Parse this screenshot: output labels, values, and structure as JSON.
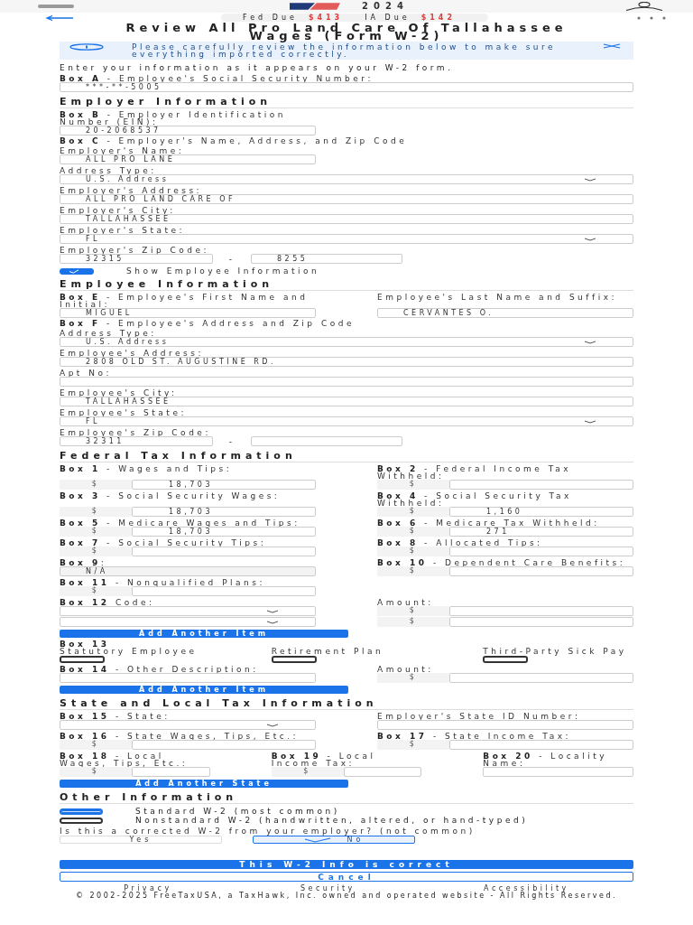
{
  "top_bar": {
    "year": "2024"
  },
  "due_bar": {
    "items": [
      {
        "label": "Fed Due",
        "amount": "$413"
      },
      {
        "label": "IA Due",
        "amount": "$142"
      }
    ]
  },
  "title": "Review All Pro Land Care Of Tallahassee Wages (Form W-2)",
  "alert": {
    "text": "Please carefully review the information below to make sure everything imported correctly."
  },
  "intro": "Enter your information as it appears on your W-2 form.",
  "blocks": [
    {
      "kind": "field",
      "label": "**Box A** - Employee's Social Security Number:",
      "inputs": [
        {
          "kind": "text",
          "value": "***-**-5005"
        }
      ]
    },
    {
      "kind": "heading",
      "text": "Employer Information"
    },
    {
      "kind": "pair",
      "cells": [
        {
          "label": "**Box B** - Employer Identification Number (EIN):",
          "inputs": [
            {
              "kind": "text",
              "value": "20-2068537"
            }
          ]
        }
      ]
    },
    {
      "kind": "note",
      "text": "**Box C** - Employer's Name, Address, and Zip Code"
    },
    {
      "kind": "pair",
      "cells": [
        {
          "label": "Employer's Name:",
          "inputs": [
            {
              "kind": "text",
              "value": "ALL PRO LANE"
            }
          ]
        }
      ]
    },
    {
      "kind": "field",
      "label": "Address Type:",
      "inputs": [
        {
          "kind": "select",
          "value": "U.S. Address"
        }
      ]
    },
    {
      "kind": "field",
      "label": "Employer's Address:",
      "inputs": [
        {
          "kind": "text",
          "value": "ALL PRO LAND CARE OF"
        }
      ]
    },
    {
      "kind": "field",
      "label": "Employer's City:",
      "inputs": [
        {
          "kind": "text",
          "value": "TALLAHASSEE"
        }
      ]
    },
    {
      "kind": "field",
      "label": "Employer's State:",
      "inputs": [
        {
          "kind": "select",
          "value": "FL"
        }
      ]
    },
    {
      "kind": "zip",
      "label": "Employer's Zip Code:",
      "joiner": "-",
      "inputs": [
        {
          "kind": "text",
          "value": "32315"
        },
        {
          "kind": "text",
          "value": "8255"
        }
      ]
    },
    {
      "kind": "checkbox",
      "label": "Show Employee Information",
      "checked": true
    },
    {
      "kind": "heading",
      "text": "Employee Information"
    },
    {
      "kind": "pair",
      "cells": [
        {
          "label": "**Box E** - Employee's First Name and Initial:",
          "inputs": [
            {
              "kind": "text",
              "value": "MIGUEL"
            }
          ]
        },
        {
          "label": "Employee's Last Name and Suffix:",
          "inputs": [
            {
              "kind": "text",
              "value": "CERVANTES O."
            }
          ]
        }
      ]
    },
    {
      "kind": "note",
      "text": "**Box F** - Employee's Address and Zip Code"
    },
    {
      "kind": "field",
      "label": "Address Type:",
      "inputs": [
        {
          "kind": "select",
          "value": "U.S. Address"
        }
      ]
    },
    {
      "kind": "field",
      "label": "Employee's Address:",
      "inputs": [
        {
          "kind": "text",
          "value": "2808 OLD ST. AUGUSTINE RD."
        }
      ]
    },
    {
      "kind": "field",
      "label": "Apt No:",
      "inputs": [
        {
          "kind": "text"
        }
      ]
    },
    {
      "kind": "field",
      "label": "Employee's City:",
      "inputs": [
        {
          "kind": "text",
          "value": "TALLAHASSEE"
        }
      ]
    },
    {
      "kind": "field",
      "label": "Employee's State:",
      "inputs": [
        {
          "kind": "select",
          "value": "FL"
        }
      ]
    },
    {
      "kind": "zip",
      "label": "Employee's Zip Code:",
      "joiner": "-",
      "inputs": [
        {
          "kind": "text",
          "value": "32311"
        },
        {
          "kind": "text"
        }
      ]
    },
    {
      "kind": "heading",
      "text": "Federal Tax Information"
    },
    {
      "kind": "pair",
      "cells": [
        {
          "label": "**Box 1** - Wages and Tips:",
          "inputs": [
            {
              "kind": "money",
              "prefix": "$",
              "value": "18,703"
            }
          ]
        },
        {
          "label": "**Box 2** - Federal Income Tax Withheld:",
          "inputs": [
            {
              "kind": "money",
              "prefix": "$"
            }
          ]
        }
      ]
    },
    {
      "kind": "pair",
      "cells": [
        {
          "label": "**Box 3** - Social Security Wages:",
          "inputs": [
            {
              "kind": "money",
              "prefix": "$",
              "value": "18,703"
            }
          ]
        },
        {
          "label": "**Box 4** - Social Security Tax Withheld:",
          "inputs": [
            {
              "kind": "money",
              "prefix": "$",
              "value": "1,160"
            }
          ]
        }
      ]
    },
    {
      "kind": "pair",
      "cells": [
        {
          "label": "**Box 5** - Medicare Wages and Tips:",
          "inputs": [
            {
              "kind": "money",
              "prefix": "$",
              "value": "18,703"
            }
          ]
        },
        {
          "label": "**Box 6** - Medicare Tax Withheld:",
          "inputs": [
            {
              "kind": "money",
              "prefix": "$",
              "value": "271"
            }
          ]
        }
      ]
    },
    {
      "kind": "pair",
      "cells": [
        {
          "label": "**Box 7** - Social Security Tips:",
          "inputs": [
            {
              "kind": "money",
              "prefix": "$"
            }
          ]
        },
        {
          "label": "**Box 8** - Allocated Tips:",
          "inputs": [
            {
              "kind": "money",
              "prefix": "$"
            }
          ]
        }
      ]
    },
    {
      "kind": "pair",
      "cells": [
        {
          "label": "**Box 9**:",
          "inputs": [
            {
              "kind": "text",
              "value": "N/A",
              "disabled": true
            }
          ]
        },
        {
          "label": "**Box 10** - Dependent Care Benefits:",
          "inputs": [
            {
              "kind": "money",
              "prefix": "$"
            }
          ]
        }
      ]
    },
    {
      "kind": "pair",
      "cells": [
        {
          "label": "**Box 11** - Nonqualified Plans:",
          "inputs": [
            {
              "kind": "money",
              "prefix": "$"
            }
          ]
        }
      ]
    },
    {
      "kind": "pair",
      "cells": [
        {
          "label": "**Box 12** Code:",
          "inputs": [
            {
              "kind": "select"
            },
            {
              "kind": "select"
            }
          ]
        },
        {
          "label": "Amount:",
          "inputs": [
            {
              "kind": "money",
              "prefix": "$"
            },
            {
              "kind": "money",
              "prefix": "$"
            }
          ]
        }
      ]
    },
    {
      "kind": "button",
      "text": "Add Another Item"
    },
    {
      "kind": "checkgroup",
      "label": "**Box 13**",
      "options": [
        {
          "label": "Statutory Employee",
          "checked": false
        },
        {
          "label": "Retirement Plan",
          "checked": false
        },
        {
          "label": "Third-Party Sick Pay",
          "checked": false
        }
      ]
    },
    {
      "kind": "pair",
      "cells": [
        {
          "label": "**Box 14** - Other Description:",
          "inputs": [
            {
              "kind": "text"
            }
          ]
        },
        {
          "label": "Amount:",
          "inputs": [
            {
              "kind": "money",
              "prefix": "$"
            }
          ]
        }
      ]
    },
    {
      "kind": "button",
      "text": "Add Another Item"
    },
    {
      "kind": "heading",
      "text": "State and Local Tax Information"
    },
    {
      "kind": "pair",
      "cells": [
        {
          "label": "**Box 15** - State:",
          "inputs": [
            {
              "kind": "select"
            }
          ]
        },
        {
          "label": "Employer's State ID Number:",
          "inputs": [
            {
              "kind": "text"
            }
          ]
        }
      ]
    },
    {
      "kind": "pair",
      "cells": [
        {
          "label": "**Box 16** - State Wages, Tips, Etc.:",
          "inputs": [
            {
              "kind": "money",
              "prefix": "$"
            }
          ]
        },
        {
          "label": "**Box 17** - State Income Tax:",
          "inputs": [
            {
              "kind": "money",
              "prefix": "$"
            }
          ]
        }
      ]
    },
    {
      "kind": "trio",
      "cells": [
        {
          "label": "**Box 18** - Local Wages, Tips, Etc.:",
          "inputs": [
            {
              "kind": "money",
              "prefix": "$"
            }
          ]
        },
        {
          "label": "**Box 19** - Local Income Tax:",
          "inputs": [
            {
              "kind": "money",
              "prefix": "$"
            }
          ]
        },
        {
          "label": "**Box 20** - Locality Name:",
          "inputs": [
            {
              "kind": "text"
            }
          ]
        }
      ]
    },
    {
      "kind": "button",
      "text": "Add Another State"
    },
    {
      "kind": "heading",
      "text": "Other Information"
    },
    {
      "kind": "radio",
      "options": [
        {
          "label": "Standard W-2 (most common)",
          "selected": true
        },
        {
          "label": "Nonstandard W-2 (handwritten, altered, or hand-typed)",
          "selected": false
        }
      ]
    },
    {
      "kind": "choice",
      "label": "Is this a corrected W-2 from your employer? (not common)",
      "options": [
        {
          "label": "Yes",
          "selected": false
        },
        {
          "label": "No",
          "selected": true
        }
      ]
    }
  ],
  "actions": {
    "primary": "This W-2 Info is correct",
    "secondary": "Cancel"
  },
  "footer": {
    "links": [
      "Privacy",
      "Security",
      "Accessibility"
    ],
    "copyright": "© 2002-2025 FreeTaxUSA, a TaxHawk, Inc. owned and operated website - All Rights Reserved."
  }
}
